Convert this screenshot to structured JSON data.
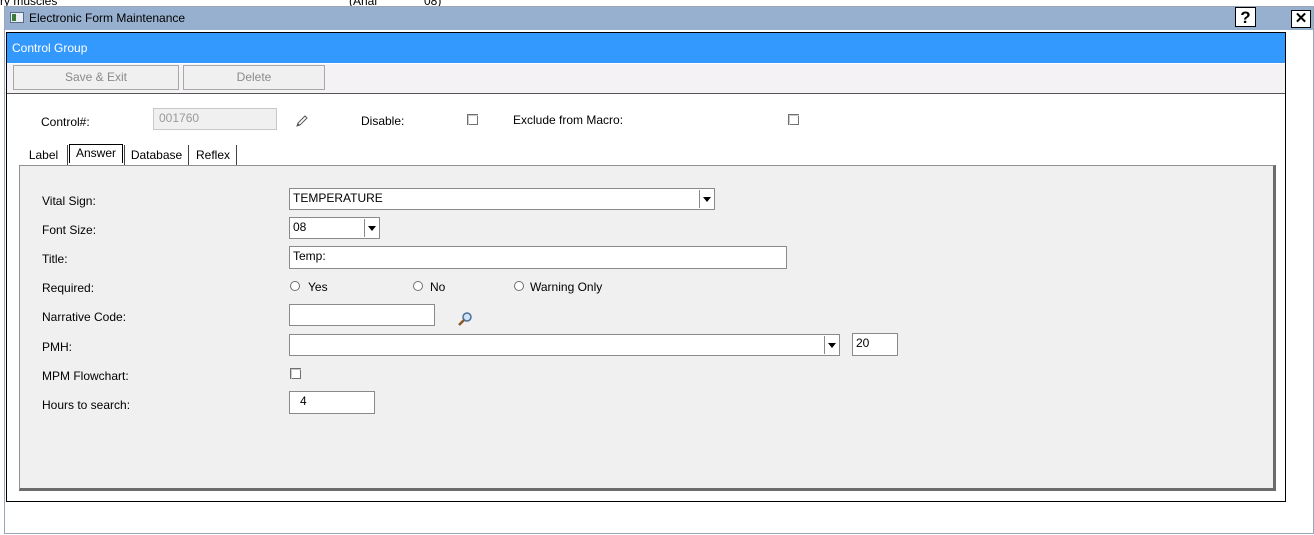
{
  "background": {
    "bleed_text": [
      "ry muscles",
      "(Arial",
      "08)"
    ]
  },
  "window": {
    "title": "Electronic Form Maintenance",
    "help_label": "?",
    "close_label": "✕"
  },
  "group": {
    "title": "Control Group"
  },
  "toolbar": {
    "save_exit": "Save & Exit",
    "delete": "Delete"
  },
  "control": {
    "label": "Control#:",
    "value": "001760",
    "disable_label": "Disable:",
    "exclude_label": "Exclude from Macro:"
  },
  "tabs": [
    "Label",
    "Answer",
    "Database",
    "Reflex"
  ],
  "active_tab": "Answer",
  "form": {
    "vital_sign": {
      "label": "Vital Sign:",
      "value": "TEMPERATURE"
    },
    "font_size": {
      "label": "Font Size:",
      "value": "08"
    },
    "title": {
      "label": "Title:",
      "value": "Temp:"
    },
    "required": {
      "label": "Required:",
      "options": [
        "Yes",
        "No",
        "Warning Only"
      ]
    },
    "narrative_code": {
      "label": "Narrative Code:",
      "value": ""
    },
    "pmh": {
      "label": "PMH:",
      "value": "",
      "number": "20"
    },
    "mpm_flowchart": {
      "label": "MPM Flowchart:"
    },
    "hours_to_search": {
      "label": "Hours to search:",
      "value": "4"
    }
  },
  "colors": {
    "titlebar": "#97b0d0",
    "group_header": "#3399ff",
    "tab_body": "#f0f0f0"
  }
}
